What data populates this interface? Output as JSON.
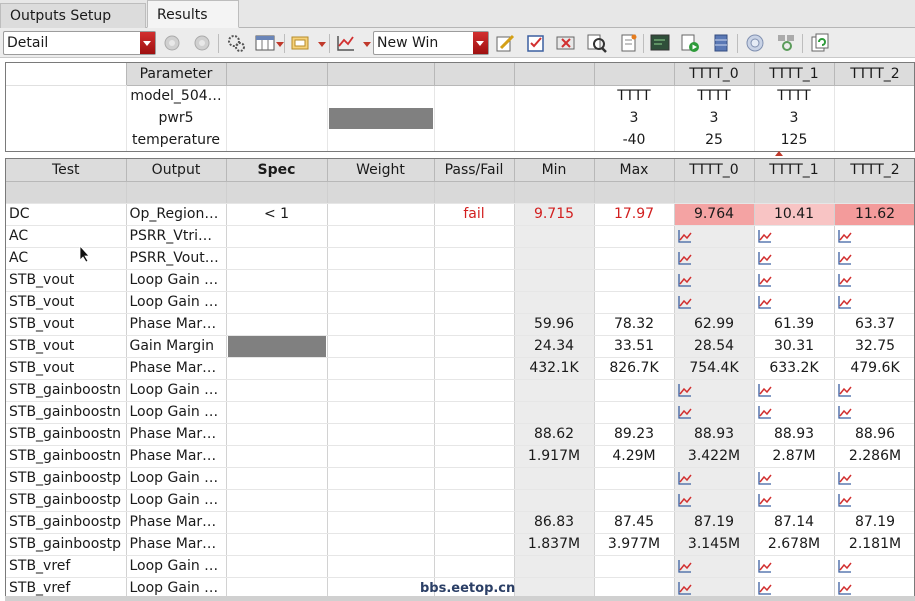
{
  "tabs": [
    "Outputs Setup",
    "Results"
  ],
  "toolbar": {
    "view_select": "Detail",
    "window_select": "New Win"
  },
  "param_table": {
    "header": [
      "Parameter",
      "",
      "",
      "",
      "",
      "",
      "TTTT_0",
      "TTTT_1",
      "TTTT_2"
    ],
    "rows": [
      {
        "name": "model_504…",
        "values": [
          "TTTT",
          "TTTT",
          "TTTT"
        ]
      },
      {
        "name": "pwr5",
        "values": [
          "3",
          "3",
          "3"
        ]
      },
      {
        "name": "temperature",
        "values": [
          "-40",
          "25",
          "125"
        ]
      }
    ]
  },
  "results_table": {
    "header": [
      "Test",
      "Output",
      "Spec",
      "Weight",
      "Pass/Fail",
      "Min",
      "Max",
      "TTTT_0",
      "TTTT_1",
      "TTTT_2"
    ],
    "rows": [
      {
        "test": "DC",
        "output": "Op_Region…",
        "spec": "< 1",
        "pass": "fail",
        "min": "9.715",
        "max": "17.97",
        "c0": "9.764",
        "c1": "10.41",
        "c2": "11.62"
      },
      {
        "test": "AC",
        "output": "PSRR_Vtrim…",
        "plot": true
      },
      {
        "test": "AC",
        "output": "PSRR_Vout…",
        "plot": true
      },
      {
        "test": "STB_vout",
        "output": "Loop Gain …",
        "plot": true
      },
      {
        "test": "STB_vout",
        "output": "Loop Gain …",
        "plot": true
      },
      {
        "test": "STB_vout",
        "output": "Phase Mar…",
        "min": "59.96",
        "max": "78.32",
        "c0": "62.99",
        "c1": "61.39",
        "c2": "63.37"
      },
      {
        "test": "STB_vout",
        "output": "Gain Margin",
        "min": "24.34",
        "max": "33.51",
        "c0": "28.54",
        "c1": "30.31",
        "c2": "32.75"
      },
      {
        "test": "STB_vout",
        "output": "Phase Mar…",
        "min": "432.1K",
        "max": "826.7K",
        "c0": "754.4K",
        "c1": "633.2K",
        "c2": "479.6K"
      },
      {
        "test": "STB_gainboostn",
        "output": "Loop Gain …",
        "plot": true
      },
      {
        "test": "STB_gainboostn",
        "output": "Loop Gain …",
        "plot": true
      },
      {
        "test": "STB_gainboostn",
        "output": "Phase Mar…",
        "min": "88.62",
        "max": "89.23",
        "c0": "88.93",
        "c1": "88.93",
        "c2": "88.96"
      },
      {
        "test": "STB_gainboostn",
        "output": "Phase Mar…",
        "min": "1.917M",
        "max": "4.29M",
        "c0": "3.422M",
        "c1": "2.87M",
        "c2": "2.286M"
      },
      {
        "test": "STB_gainboostp",
        "output": "Loop Gain …",
        "plot": true
      },
      {
        "test": "STB_gainboostp",
        "output": "Loop Gain …",
        "plot": true
      },
      {
        "test": "STB_gainboostp",
        "output": "Phase Mar…",
        "min": "86.83",
        "max": "87.45",
        "c0": "87.19",
        "c1": "87.14",
        "c2": "87.19"
      },
      {
        "test": "STB_gainboostp",
        "output": "Phase Mar…",
        "min": "1.837M",
        "max": "3.977M",
        "c0": "3.145M",
        "c1": "2.678M",
        "c2": "2.181M"
      },
      {
        "test": "STB_vref",
        "output": "Loop Gain …",
        "plot": true
      },
      {
        "test": "STB_vref",
        "output": "Loop Gain …",
        "plot": true
      }
    ]
  },
  "watermark": "bbs.eetop.cn",
  "colors": {
    "fail_text": "#d21f1f",
    "fail_cell": "#f4a3a3",
    "header_bg": "#dcdcdc",
    "accent_red": "#c0392b"
  }
}
